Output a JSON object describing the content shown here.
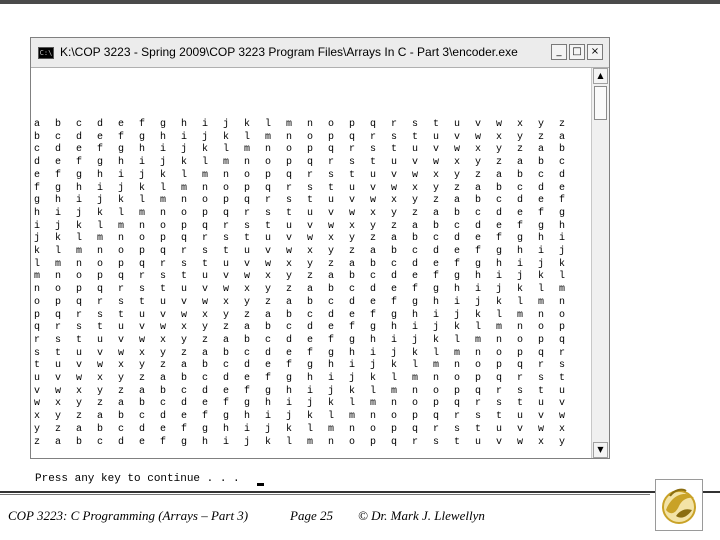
{
  "window": {
    "title": "K:\\COP 3223 - Spring 2009\\COP 3223 Program Files\\Arrays In C - Part 3\\encoder.exe",
    "icon_label": "C:\\",
    "buttons": {
      "minimize": "_",
      "maximize": "□",
      "close": "×"
    }
  },
  "console": {
    "rows": [
      "a b c d e f g h i j k l m n o p q r s t u v w x y z",
      "b c d e f g h i j k l m n o p q r s t u v w x y z a",
      "c d e f g h i j k l m n o p q r s t u v w x y z a b",
      "d e f g h i j k l m n o p q r s t u v w x y z a b c",
      "e f g h i j k l m n o p q r s t u v w x y z a b c d",
      "f g h i j k l m n o p q r s t u v w x y z a b c d e",
      "g h i j k l m n o p q r s t u v w x y z a b c d e f",
      "h i j k l m n o p q r s t u v w x y z a b c d e f g",
      "i j k l m n o p q r s t u v w x y z a b c d e f g h",
      "j k l m n o p q r s t u v w x y z a b c d e f g h i",
      "k l m n o p q r s t u v w x y z a b c d e f g h i j",
      "l m n o p q r s t u v w x y z a b c d e f g h i j k",
      "m n o p q r s t u v w x y z a b c d e f g h i j k l",
      "n o p q r s t u v w x y z a b c d e f g h i j k l m",
      "o p q r s t u v w x y z a b c d e f g h i j k l m n",
      "p q r s t u v w x y z a b c d e f g h i j k l m n o",
      "q r s t u v w x y z a b c d e f g h i j k l m n o p",
      "r s t u v w x y z a b c d e f g h i j k l m n o p q",
      "s t u v w x y z a b c d e f g h i j k l m n o p q r",
      "t u v w x y z a b c d e f g h i j k l m n o p q r s",
      "u v w x y z a b c d e f g h i j k l m n o p q r s t",
      "v w x y z a b c d e f g h i j k l m n o p q r s t u",
      "w x y z a b c d e f g h i j k l m n o p q r s t u v",
      "x y z a b c d e f g h i j k l m n o p q r s t u v w",
      "y z a b c d e f g h i j k l m n o p q r s t u v w x",
      "z a b c d e f g h i j k l m n o p q r s t u v w x y"
    ],
    "prompt": "Press any key to continue . . ."
  },
  "scrollbar": {
    "up_arrow": "▲",
    "down_arrow": "▼"
  },
  "footer": {
    "course": "COP 3223: C Programming (Arrays – Part 3)",
    "page": "Page 25",
    "author": "© Dr. Mark J. Llewellyn"
  },
  "colors": {
    "console_bg": "#ffffff",
    "logo_gold": "#c9a227"
  }
}
